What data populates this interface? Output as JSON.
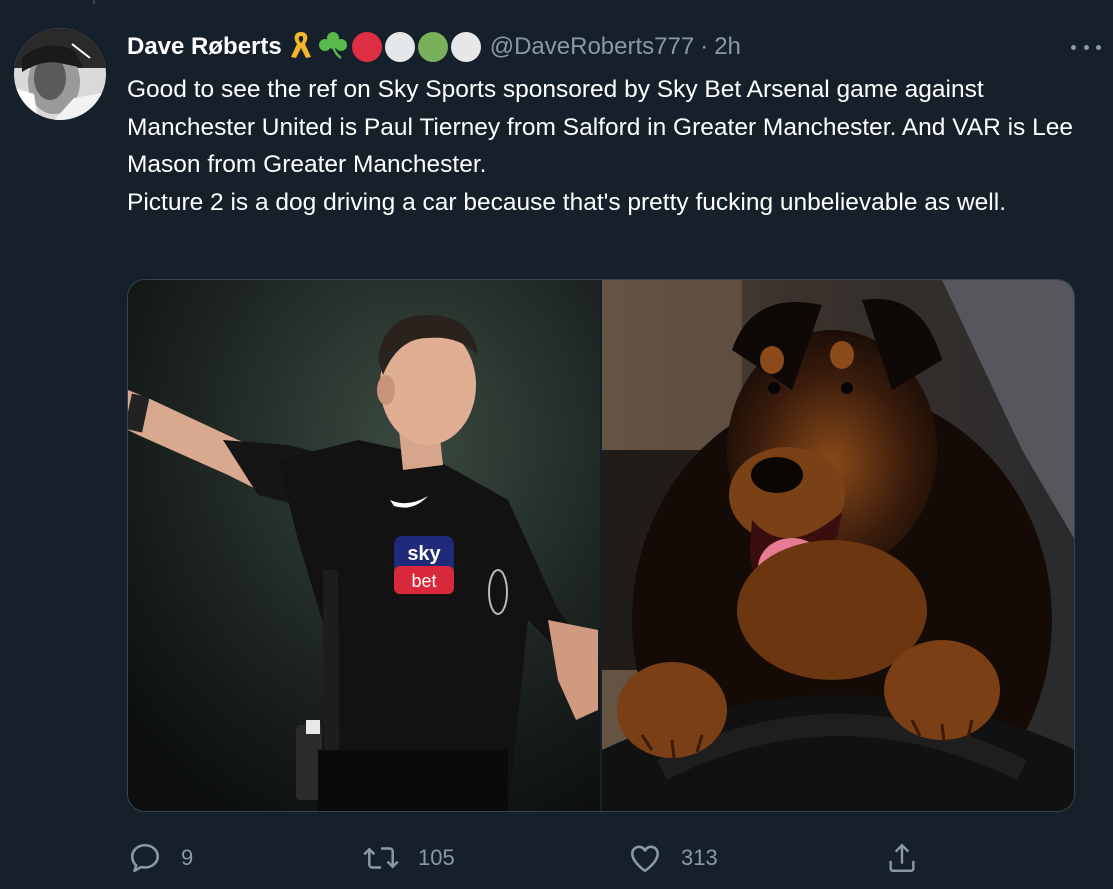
{
  "tweet": {
    "author": {
      "display_name": "Dave Røberts",
      "handle": "@DaveRoberts777",
      "emojis": [
        "ribbon-icon",
        "shamrock-icon",
        "red-circle-icon",
        "white-circle-icon",
        "green-circle-icon",
        "white-circle-icon"
      ],
      "emoji_colors": {
        "ribbon": "#f4b52c",
        "shamrock": "#59b94d",
        "red": "#dd2e44",
        "white": "#e6e7e8",
        "green": "#78b159"
      }
    },
    "separator": "·",
    "timestamp": "2h",
    "text_lines": [
      "Good to see the ref on Sky Sports sponsored by Sky Bet  Arsenal game against Manchester United is Paul Tierney from Salford in Greater Manchester. And VAR is Lee Mason from Greater Manchester.",
      "Picture 2 is a dog driving a car because that's pretty fucking unbelievable as well."
    ],
    "media": {
      "images": [
        {
          "name": "referee-photo",
          "badge_top": "sky",
          "badge_bottom": "bet"
        },
        {
          "name": "dog-driving-photo"
        }
      ]
    },
    "actions": {
      "reply_count": "9",
      "retweet_count": "105",
      "like_count": "313"
    }
  },
  "colors": {
    "background": "#15202b",
    "secondary_text": "#8b98a5",
    "border": "#38444d"
  }
}
